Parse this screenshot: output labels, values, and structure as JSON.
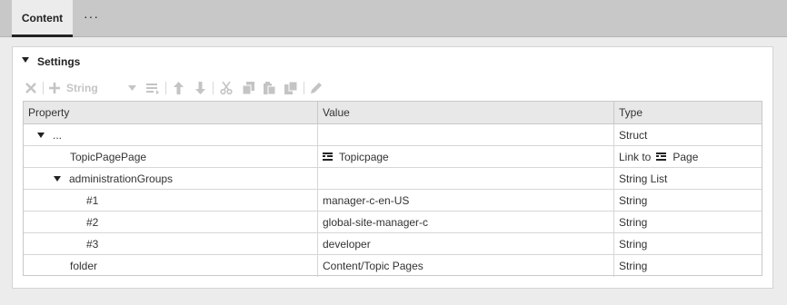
{
  "tabs": {
    "active_label": "Content",
    "more_label": "···"
  },
  "panel": {
    "title": "Settings"
  },
  "toolbar": {
    "string_label": "String"
  },
  "grid": {
    "headers": {
      "property": "Property",
      "value": "Value",
      "type": "Type"
    },
    "rows": [
      {
        "property": "...",
        "value": "",
        "type": "Struct"
      },
      {
        "property": "TopicPagePage",
        "value": "Topicpage",
        "type_prefix": "Link to",
        "type": "Page"
      },
      {
        "property": "administrationGroups",
        "value": "",
        "type": "String List"
      },
      {
        "property": "#1",
        "value": "manager-c-en-US",
        "type": "String"
      },
      {
        "property": "#2",
        "value": "global-site-manager-c",
        "type": "String"
      },
      {
        "property": "#3",
        "value": "developer",
        "type": "String"
      },
      {
        "property": "folder",
        "value": "Content/Topic Pages",
        "type": "String"
      }
    ]
  },
  "icons": {
    "toolbar": [
      "delete-icon",
      "add-icon",
      "dropdown-chevron-icon",
      "list-icon",
      "move-up-icon",
      "move-down-icon",
      "cut-icon",
      "copy-icon",
      "paste-icon",
      "paste-special-icon",
      "edit-icon"
    ],
    "row": [
      "expand-icon",
      "page-icon"
    ]
  }
}
